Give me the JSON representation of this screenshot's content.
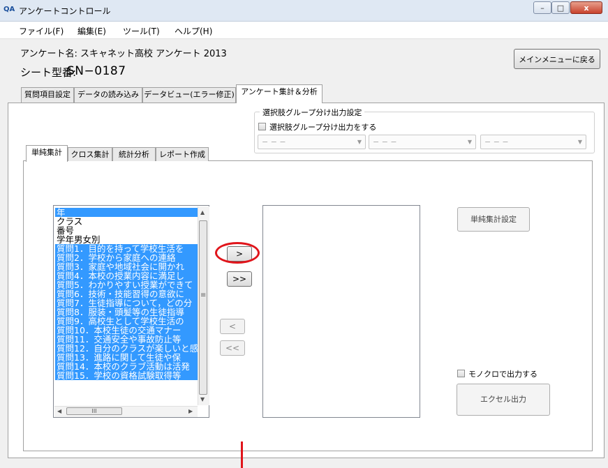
{
  "window": {
    "icon": "QA",
    "title": "アンケートコントロール",
    "min": "–",
    "max": "□",
    "close": "x"
  },
  "menu": [
    "ファイル(F)",
    "編集(E)",
    "ツール(T)",
    "ヘルプ(H)"
  ],
  "info": {
    "survey_name": "アンケート名: スキャネット高校 アンケート 2013",
    "sheet_label": "シート型番:",
    "sheet_value": "SN−0187"
  },
  "back_button": "メインメニューに戻る",
  "main_tabs": [
    "質問項目設定",
    "データの読み込み",
    "データビュー(エラー修正)",
    "アンケート集計＆分析"
  ],
  "group": {
    "title": "選択肢グループ分け出力設定",
    "checkbox_label": "選択肢グループ分け出力をする",
    "combo_1": "− − −",
    "combo_2": "− − −",
    "combo_3": "− − −"
  },
  "sub_tabs": [
    "単純集計",
    "クロス集計",
    "統計分析",
    "レポート作成"
  ],
  "source_list": [
    "年",
    "クラス",
    "番号",
    "学年男女別",
    "質問1．目的を持って学校生活を",
    "質問2．学校から家庭への連絡",
    "質問3．家庭や地域社会に開かれ",
    "質問4．本校の授業内容に満足し",
    "質問5．わかりやすい授業ができて",
    "質問6．技術・技能習得の意欲に",
    "質問7．生徒指導について，どの分",
    "質問8．服装・頭髪等の生徒指導",
    "質問9．高校生として学校生活の",
    "質問10．本校生徒の交通マナー",
    "質問11．交通安全や事故防止等",
    "質問12．自分のクラスが楽しいと感",
    "質問13．進路に関して生徒や保",
    "質問14．本校のクラブ活動は活発",
    "質問15．学校の資格試験取得等"
  ],
  "selected_rows": [
    true,
    false,
    false,
    false,
    true,
    true,
    true,
    true,
    true,
    true,
    true,
    true,
    true,
    true,
    true,
    true,
    true,
    true,
    true
  ],
  "move_buttons": {
    "add": ">",
    "add_all": ">>",
    "remove": "<",
    "remove_all": "<<"
  },
  "simple_settings_button": "単純集計設定",
  "mono_label": "モノクロで出力する",
  "excel_button": "エクセル出力",
  "scroll": {
    "up": "▲",
    "down": "▼",
    "left": "◀",
    "right": "▶",
    "grip": "III",
    "mid": "≡"
  }
}
